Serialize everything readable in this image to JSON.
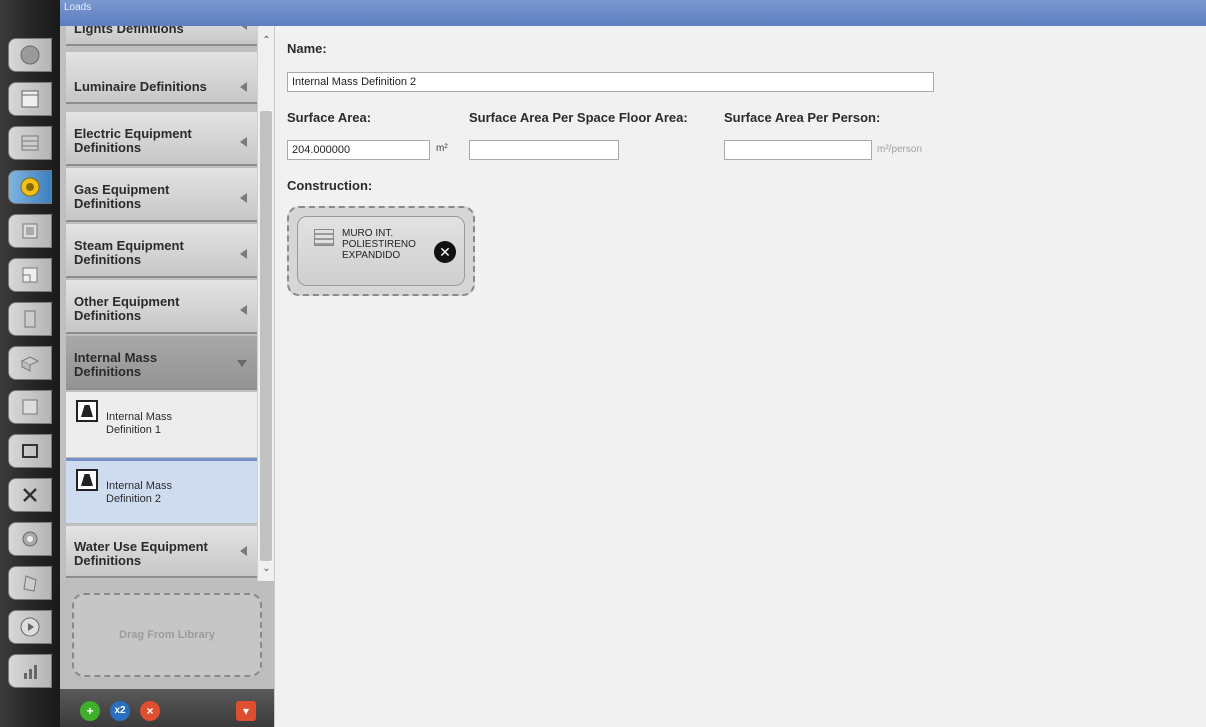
{
  "window": {
    "title": "Loads"
  },
  "rail": {
    "tabs": [
      {
        "icon": "site-icon"
      },
      {
        "icon": "schedules-icon"
      },
      {
        "icon": "constructions-icon"
      },
      {
        "icon": "loads-icon",
        "active": true
      },
      {
        "icon": "space-types-icon"
      },
      {
        "icon": "geometry-icon"
      },
      {
        "icon": "facility-icon"
      },
      {
        "icon": "spaces-icon"
      },
      {
        "icon": "thermal-zones-icon"
      },
      {
        "icon": "hvac-systems-icon"
      },
      {
        "icon": "variables-icon"
      },
      {
        "icon": "simulation-settings-icon"
      },
      {
        "icon": "measures-icon"
      },
      {
        "icon": "run-simulation-icon"
      },
      {
        "icon": "results-icon"
      }
    ]
  },
  "categories": {
    "lights": "Lights Definitions",
    "luminaire": "Luminaire Definitions",
    "electric": "Electric Equipment Definitions",
    "gas": "Gas Equipment Definitions",
    "steam": "Steam Equipment Definitions",
    "other": "Other Equipment Definitions",
    "internal_mass": "Internal Mass Definitions",
    "water_use": "Water Use Equipment Definitions"
  },
  "internal_mass_items": [
    {
      "label": "Internal Mass Definition 1"
    },
    {
      "label": "Internal Mass Definition 2",
      "selected": true
    }
  ],
  "dropzone": {
    "label": "Drag From Library"
  },
  "bottombar": {
    "add": "+",
    "copy": "x2",
    "remove": "×",
    "purge": "▾"
  },
  "form": {
    "name_label": "Name:",
    "name_value": "Internal Mass Definition 2",
    "surface_area_label": "Surface Area:",
    "surface_area_value": "204.000000",
    "surface_area_unit": "m²",
    "per_floor_label": "Surface Area Per Space Floor Area:",
    "per_floor_value": "",
    "per_person_label": "Surface Area Per Person:",
    "per_person_value": "",
    "per_person_unit": "m²/person",
    "construction_label": "Construction:",
    "construction_name": "MURO INT.\nPOLIESTIRENO\nEXPANDIDO"
  }
}
